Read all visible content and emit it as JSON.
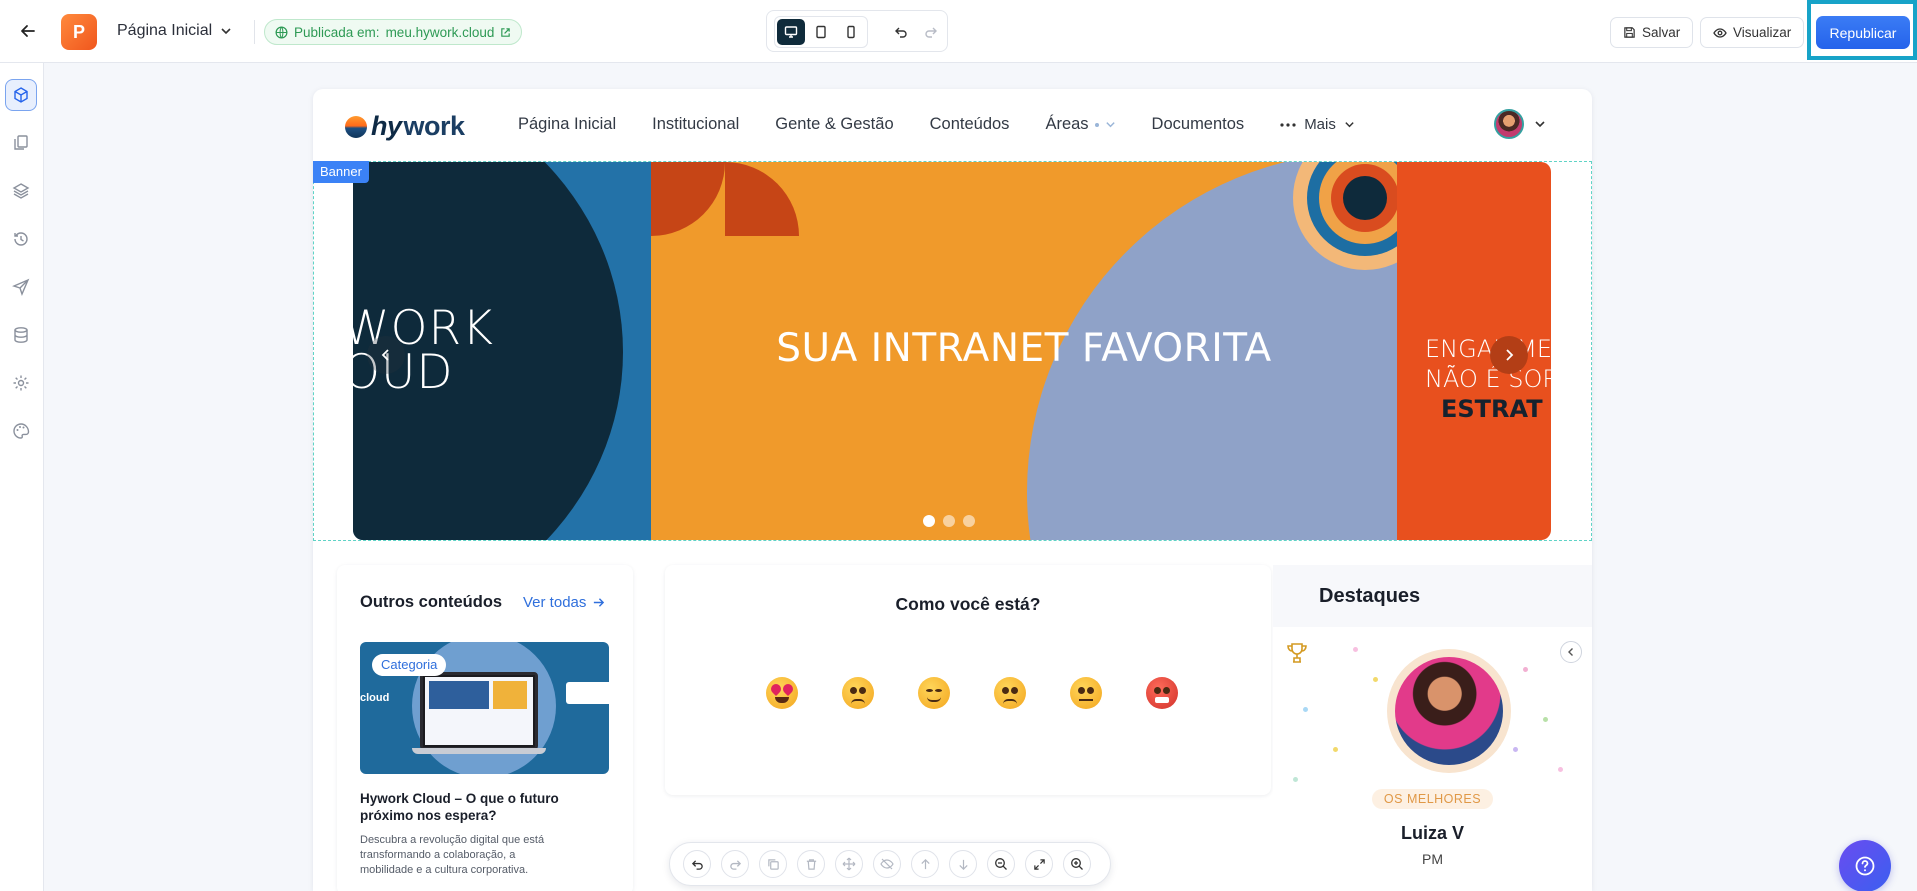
{
  "topbar": {
    "workspace_initial": "P",
    "page_name": "Página Inicial",
    "published_label": "Publicada em:",
    "published_url": "meu.hywork.cloud",
    "save_label": "Salvar",
    "preview_label": "Visualizar",
    "republish_label": "Republicar"
  },
  "site": {
    "logo_hy": "hy",
    "logo_work": "work",
    "nav": [
      "Página Inicial",
      "Institucional",
      "Gente & Gestão",
      "Conteúdos",
      "Áreas",
      "Documentos"
    ],
    "more_label": "Mais"
  },
  "banner": {
    "tag": "Banner",
    "left_text_1": "WORK",
    "left_text_2": "OUD",
    "headline": "SUA INTRANET FAVORITA",
    "right_text_1": "ENGAJAME",
    "right_text_2": "NÃO É SOR",
    "right_text_3": "ESTRAT",
    "slide_count": 3,
    "active_slide": 1
  },
  "other_contents": {
    "title": "Outros conteúdos",
    "see_all": "Ver todas",
    "post": {
      "category": "Categoria",
      "image_text": "cloud",
      "title": "Hywork Cloud – O que o futuro próximo nos espera?",
      "description": "Descubra a revolução digital que está transformando a colaboração, a mobilidade e a cultura corporativa."
    }
  },
  "mood": {
    "question": "Como você está?",
    "emojis": [
      "heart-eyes",
      "angry",
      "smiling",
      "worried",
      "neutral",
      "cursing"
    ]
  },
  "highlights": {
    "title": "Destaques",
    "badge": "OS MELHORES",
    "name": "Luiza V",
    "role": "PM"
  },
  "colors": {
    "primary": "#2563eb",
    "published_green": "#2e9a55",
    "banner_orange": "#f09a2b",
    "banner_blue": "#2372a8",
    "banner_red": "#e8501e",
    "help_purple": "#5a4ff0"
  }
}
